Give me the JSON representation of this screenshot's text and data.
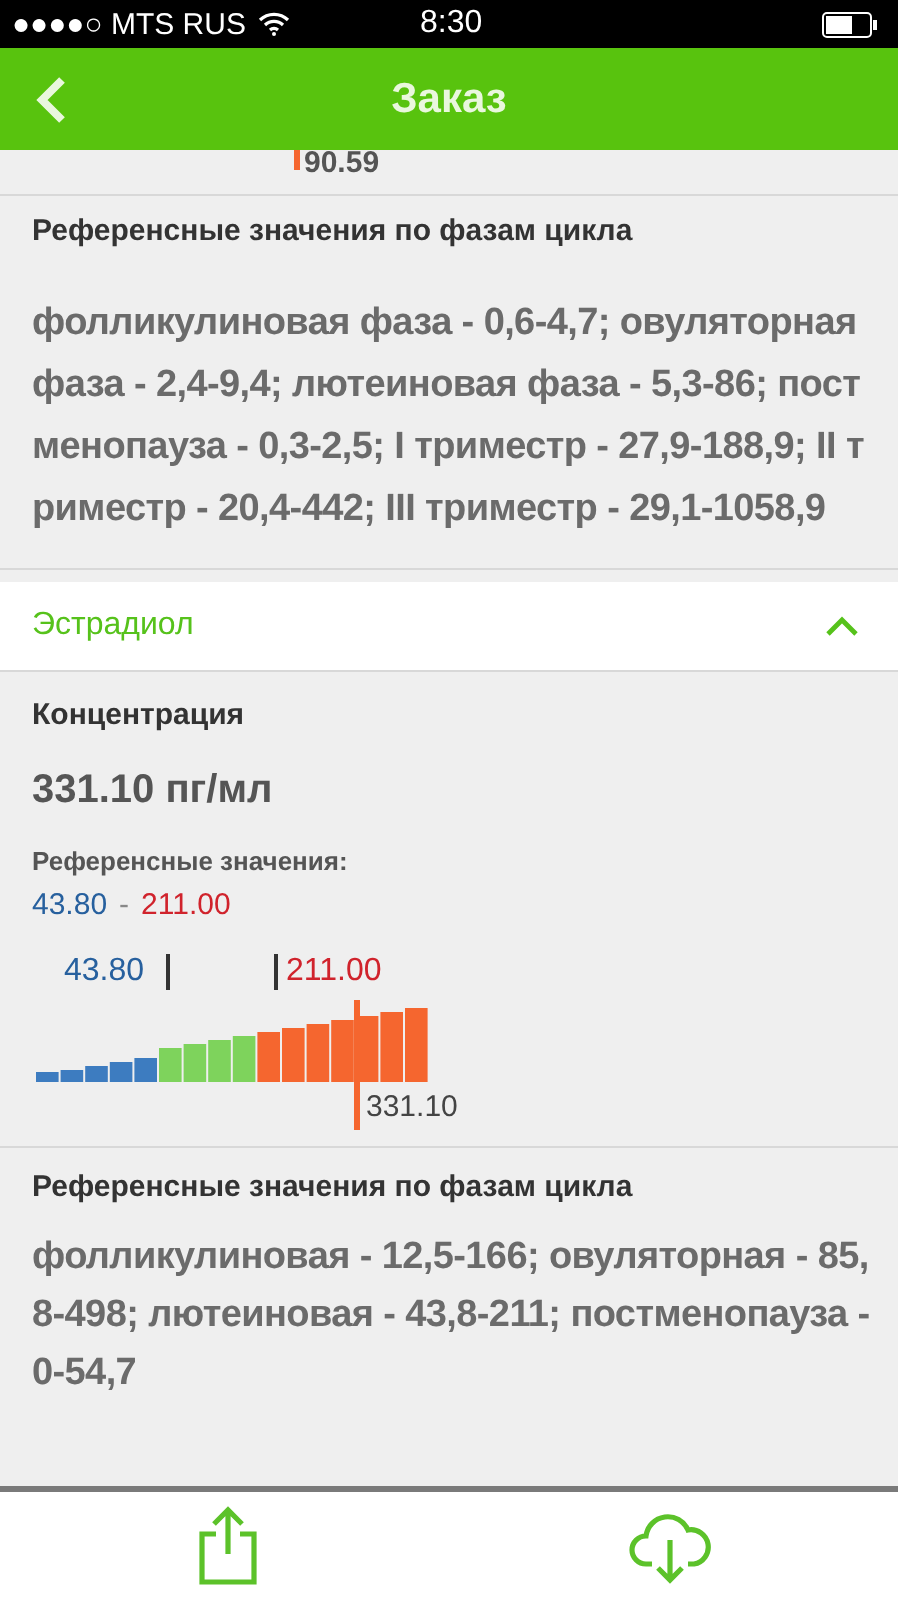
{
  "status_bar": {
    "carrier": "●●●●○ MTS RUS",
    "time": "8:30"
  },
  "header": {
    "title": "Заказ"
  },
  "previous_result": {
    "value": "90.59"
  },
  "phase_reference_top": {
    "heading": "Референсные значения по фазам цикла",
    "text": "фолликулиновая фаза - 0,6-4,7; овуляторная фаза - 2,4-9,4; лютеиновая фаза - 5,3-86; постменопауза - 0,3-2,5; I триместр - 27,9-188,9; II триместр - 20,4-442; III триместр - 29,1-1058,9"
  },
  "section": {
    "title": "Эстрадиол",
    "expanded": true
  },
  "concentration": {
    "label": "Концентрация",
    "value": "331.10 пг/мл"
  },
  "reference": {
    "label": "Референсные значения:",
    "low": "43.80",
    "separator": "-",
    "high": "211.00"
  },
  "scale": {
    "low_label": "43.80",
    "high_label": "211.00",
    "result_label": "331.10"
  },
  "phase_reference_bottom": {
    "heading": "Референсные значения по фазам цикла",
    "text": "фолликулиновая - 12,5-166; овуляторная - 85,8-498; лютеиновая - 43,8-211; постменопауза - 0-54,7"
  }
}
